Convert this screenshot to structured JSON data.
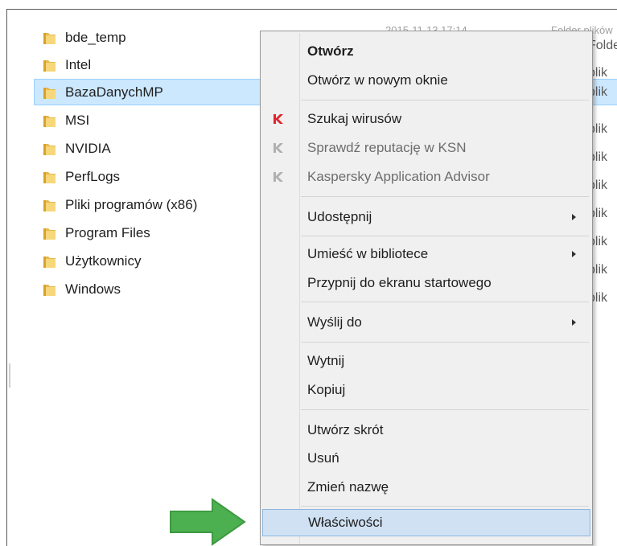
{
  "files": [
    {
      "name": "bde_temp",
      "type": "Folder plików"
    },
    {
      "name": "Intel",
      "type": "plik"
    },
    {
      "name": "BazaDanychMP",
      "type": "plik",
      "selected": true
    },
    {
      "name": "MSI",
      "type": "plik"
    },
    {
      "name": "NVIDIA",
      "type": "plik"
    },
    {
      "name": "PerfLogs",
      "type": "plik"
    },
    {
      "name": "Pliki programów (x86)",
      "type": "plik"
    },
    {
      "name": "Program Files",
      "type": "plik"
    },
    {
      "name": "Użytkownicy",
      "type": "plik"
    },
    {
      "name": "Windows",
      "type": "plik"
    }
  ],
  "header_fragments": {
    "date": "2015-11-13 17:14",
    "type": "Folder plików"
  },
  "menu": {
    "open": "Otwórz",
    "open_new_window": "Otwórz w nowym oknie",
    "scan_viruses": "Szukaj wirusów",
    "check_reputation": "Sprawdź reputację w KSN",
    "kaspersky_advisor": "Kaspersky Application Advisor",
    "share": "Udostępnij",
    "include_library": "Umieść w bibliotece",
    "pin_start": "Przypnij do ekranu startowego",
    "send_to": "Wyślij do",
    "cut": "Wytnij",
    "copy": "Kopiuj",
    "create_shortcut": "Utwórz skrót",
    "delete": "Usuń",
    "rename": "Zmień nazwę",
    "properties": "Właściwości"
  },
  "colors": {
    "selection": "#cce8ff",
    "menu_hover": "#cfe1f3",
    "kaspersky_red": "#e0262b",
    "arrow_green": "#4caf50"
  },
  "icons": {
    "folder": "folder-icon",
    "kaspersky": "kaspersky-icon",
    "submenu": "chevron-right-icon",
    "pointer": "green-arrow-icon"
  }
}
